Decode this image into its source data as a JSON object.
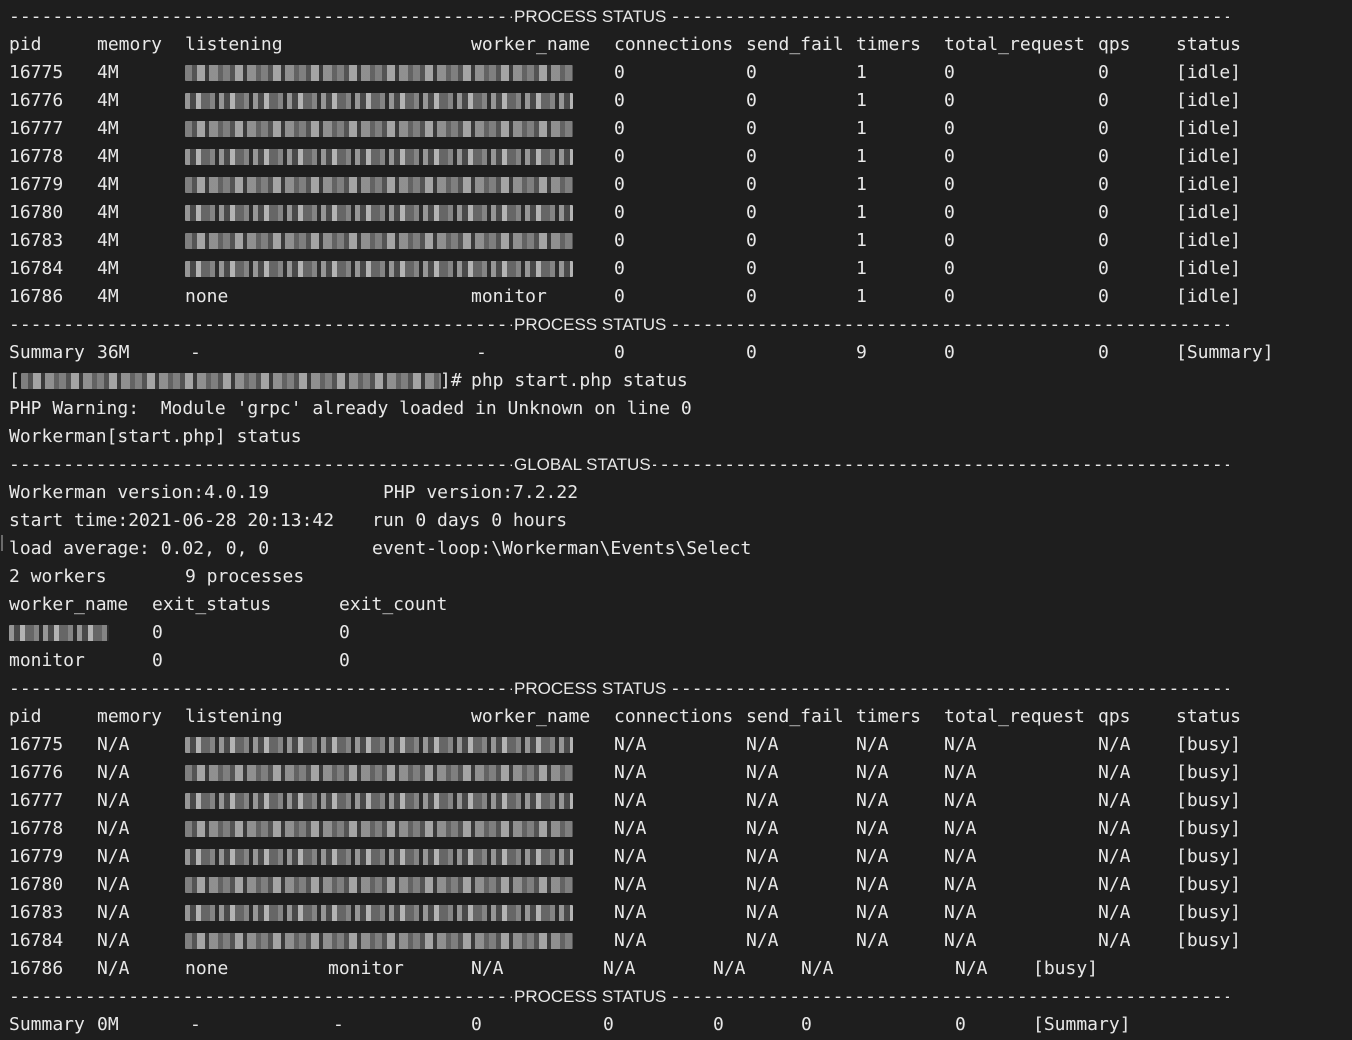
{
  "terminal": {
    "sections": {
      "process_status_title": "PROCESS STATUS",
      "global_status_title": "GLOBAL STATUS"
    },
    "headers": {
      "pid": "pid",
      "memory": "memory",
      "listening": "listening",
      "worker_name": "worker_name",
      "connections": "connections",
      "send_fail": "send_fail",
      "timers": "timers",
      "total_request": "total_request",
      "qps": "qps",
      "status": "status"
    },
    "table1": {
      "rows": [
        {
          "pid": "16775",
          "memory": "4M",
          "connections": "0",
          "send_fail": "0",
          "timers": "1",
          "total_request": "0",
          "qps": "0",
          "status": "[idle]"
        },
        {
          "pid": "16776",
          "memory": "4M",
          "connections": "0",
          "send_fail": "0",
          "timers": "1",
          "total_request": "0",
          "qps": "0",
          "status": "[idle]"
        },
        {
          "pid": "16777",
          "memory": "4M",
          "connections": "0",
          "send_fail": "0",
          "timers": "1",
          "total_request": "0",
          "qps": "0",
          "status": "[idle]"
        },
        {
          "pid": "16778",
          "memory": "4M",
          "connections": "0",
          "send_fail": "0",
          "timers": "1",
          "total_request": "0",
          "qps": "0",
          "status": "[idle]"
        },
        {
          "pid": "16779",
          "memory": "4M",
          "connections": "0",
          "send_fail": "0",
          "timers": "1",
          "total_request": "0",
          "qps": "0",
          "status": "[idle]"
        },
        {
          "pid": "16780",
          "memory": "4M",
          "connections": "0",
          "send_fail": "0",
          "timers": "1",
          "total_request": "0",
          "qps": "0",
          "status": "[idle]"
        },
        {
          "pid": "16783",
          "memory": "4M",
          "connections": "0",
          "send_fail": "0",
          "timers": "1",
          "total_request": "0",
          "qps": "0",
          "status": "[idle]"
        },
        {
          "pid": "16784",
          "memory": "4M",
          "connections": "0",
          "send_fail": "0",
          "timers": "1",
          "total_request": "0",
          "qps": "0",
          "status": "[idle]"
        }
      ],
      "monitor_row": {
        "pid": "16786",
        "memory": "4M",
        "listening": "none",
        "worker_name": "monitor",
        "connections": "0",
        "send_fail": "0",
        "timers": "1",
        "total_request": "0",
        "qps": "0",
        "status": "[idle]"
      },
      "summary": {
        "label": "Summary",
        "memory": "36M",
        "listening": "-",
        "worker_name": "-",
        "connections": "0",
        "send_fail": "0",
        "timers": "9",
        "total_request": "0",
        "qps": "0",
        "status": "[Summary]"
      }
    },
    "prompt": {
      "open": "[",
      "close": "]#",
      "command": "php start.php status"
    },
    "warning": "PHP Warning:  Module 'grpc' already loaded in Unknown on line 0",
    "workerman_status": "Workerman[start.php] status",
    "global": {
      "workerman_version": "Workerman version:4.0.19",
      "php_version": "PHP version:7.2.22",
      "start_time": "start time:2021-06-28 20:13:42",
      "run_time": "run 0 days 0 hours",
      "load_average": "load average: 0.02, 0, 0",
      "event_loop": "event-loop:\\Workerman\\Events\\Select",
      "workers": "2 workers",
      "processes": "9 processes",
      "exit_headers": {
        "worker_name": "worker_name",
        "exit_status": "exit_status",
        "exit_count": "exit_count"
      },
      "exit_rows": [
        {
          "worker_name": "",
          "exit_status": "0",
          "exit_count": "0"
        },
        {
          "worker_name": "monitor",
          "exit_status": "0",
          "exit_count": "0"
        }
      ]
    },
    "table2": {
      "rows": [
        {
          "pid": "16775",
          "memory": "N/A",
          "connections": "N/A",
          "send_fail": "N/A",
          "timers": "N/A",
          "total_request": "N/A",
          "qps": "N/A",
          "status": "[busy]"
        },
        {
          "pid": "16776",
          "memory": "N/A",
          "connections": "N/A",
          "send_fail": "N/A",
          "timers": "N/A",
          "total_request": "N/A",
          "qps": "N/A",
          "status": "[busy]"
        },
        {
          "pid": "16777",
          "memory": "N/A",
          "connections": "N/A",
          "send_fail": "N/A",
          "timers": "N/A",
          "total_request": "N/A",
          "qps": "N/A",
          "status": "[busy]"
        },
        {
          "pid": "16778",
          "memory": "N/A",
          "connections": "N/A",
          "send_fail": "N/A",
          "timers": "N/A",
          "total_request": "N/A",
          "qps": "N/A",
          "status": "[busy]"
        },
        {
          "pid": "16779",
          "memory": "N/A",
          "connections": "N/A",
          "send_fail": "N/A",
          "timers": "N/A",
          "total_request": "N/A",
          "qps": "N/A",
          "status": "[busy]"
        },
        {
          "pid": "16780",
          "memory": "N/A",
          "connections": "N/A",
          "send_fail": "N/A",
          "timers": "N/A",
          "total_request": "N/A",
          "qps": "N/A",
          "status": "[busy]"
        },
        {
          "pid": "16783",
          "memory": "N/A",
          "connections": "N/A",
          "send_fail": "N/A",
          "timers": "N/A",
          "total_request": "N/A",
          "qps": "N/A",
          "status": "[busy]"
        },
        {
          "pid": "16784",
          "memory": "N/A",
          "connections": "N/A",
          "send_fail": "N/A",
          "timers": "N/A",
          "total_request": "N/A",
          "qps": "N/A",
          "status": "[busy]"
        }
      ],
      "monitor_row": {
        "pid": "16786",
        "memory": "N/A",
        "listening": "none",
        "worker_name": "monitor",
        "connections": "N/A",
        "send_fail": "N/A",
        "timers": "N/A",
        "total_request": "N/A",
        "qps": "N/A",
        "status": "[busy]"
      },
      "summary": {
        "label": "Summary",
        "memory": "0M",
        "listening": "-",
        "worker_name": "-",
        "connections": "0",
        "send_fail": "0",
        "timers": "0",
        "total_request": "0",
        "qps": "0",
        "status": "[Summary]"
      }
    }
  },
  "colors": {
    "background": "#1e1e1e",
    "text": "#e8e8e8"
  }
}
